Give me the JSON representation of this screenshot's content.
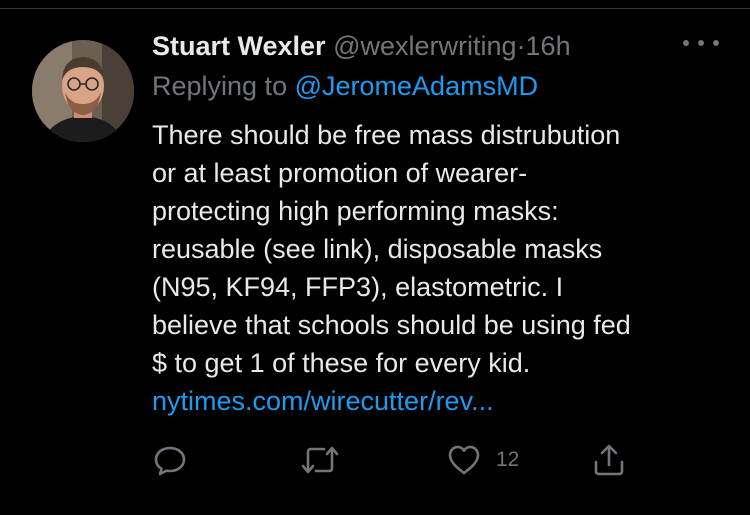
{
  "tweet": {
    "author_name": "Stuart Wexler",
    "handle": "@wexlerwriting",
    "separator": "·",
    "time": "16h",
    "reply_label": "Replying to",
    "reply_to": "@JeromeAdamsMD",
    "body_lines": [
      "There should be free mass distrubution",
      "or at least promotion of wearer-",
      "protecting high performing masks:",
      "reusable (see link), disposable masks",
      "(N95, KF94, FFP3), elastometric. I",
      "believe that schools should be using fed",
      "$ to get 1 of these for every kid."
    ],
    "link": "nytimes.com/wirecutter/rev..."
  },
  "actions": {
    "reply_icon": "comment-icon",
    "retweet_icon": "retweet-icon",
    "like_icon": "heart-icon",
    "like_count": "12",
    "share_icon": "share-icon",
    "more_icon": "more-dots-icon"
  },
  "colors": {
    "background": "#000000",
    "text": "#e7e9ea",
    "secondary": "#71767b",
    "accent": "#1d9bf0"
  }
}
